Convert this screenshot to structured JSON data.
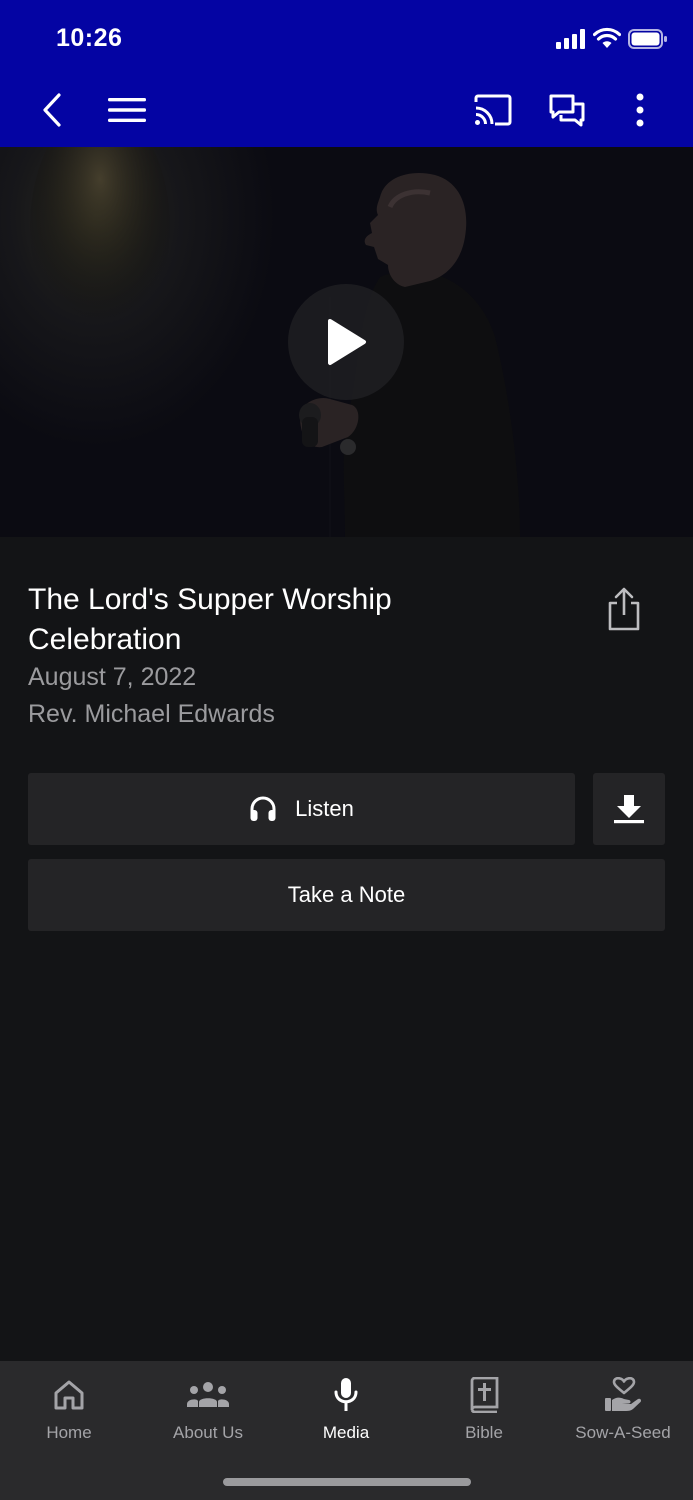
{
  "status_bar": {
    "time": "10:26"
  },
  "header": {
    "back_icon": "chevron-left-icon",
    "menu_icon": "hamburger-menu-icon",
    "cast_icon": "cast-icon",
    "chat_icon": "chat-bubbles-icon",
    "more_icon": "vertical-dots-icon",
    "background_color": "#0404a3"
  },
  "video": {
    "play_icon": "play-icon"
  },
  "sermon": {
    "title": "The Lord's Supper Worship Celebration",
    "date": "August 7, 2022",
    "speaker": "Rev. Michael Edwards",
    "share_icon": "share-icon"
  },
  "actions": {
    "listen_label": "Listen",
    "listen_icon": "headphones-icon",
    "download_icon": "download-icon",
    "note_label": "Take a Note"
  },
  "tabbar": {
    "active": "Media",
    "items": [
      {
        "label": "Home",
        "icon": "home-icon"
      },
      {
        "label": "About Us",
        "icon": "people-icon"
      },
      {
        "label": "Media",
        "icon": "microphone-icon"
      },
      {
        "label": "Bible",
        "icon": "bible-icon"
      },
      {
        "label": "Sow-A-Seed",
        "icon": "hand-heart-icon"
      }
    ]
  },
  "colors": {
    "background": "#131416",
    "button": "#242426",
    "tabbar": "#2a2a2c",
    "muted_text": "#9b9b9e"
  }
}
